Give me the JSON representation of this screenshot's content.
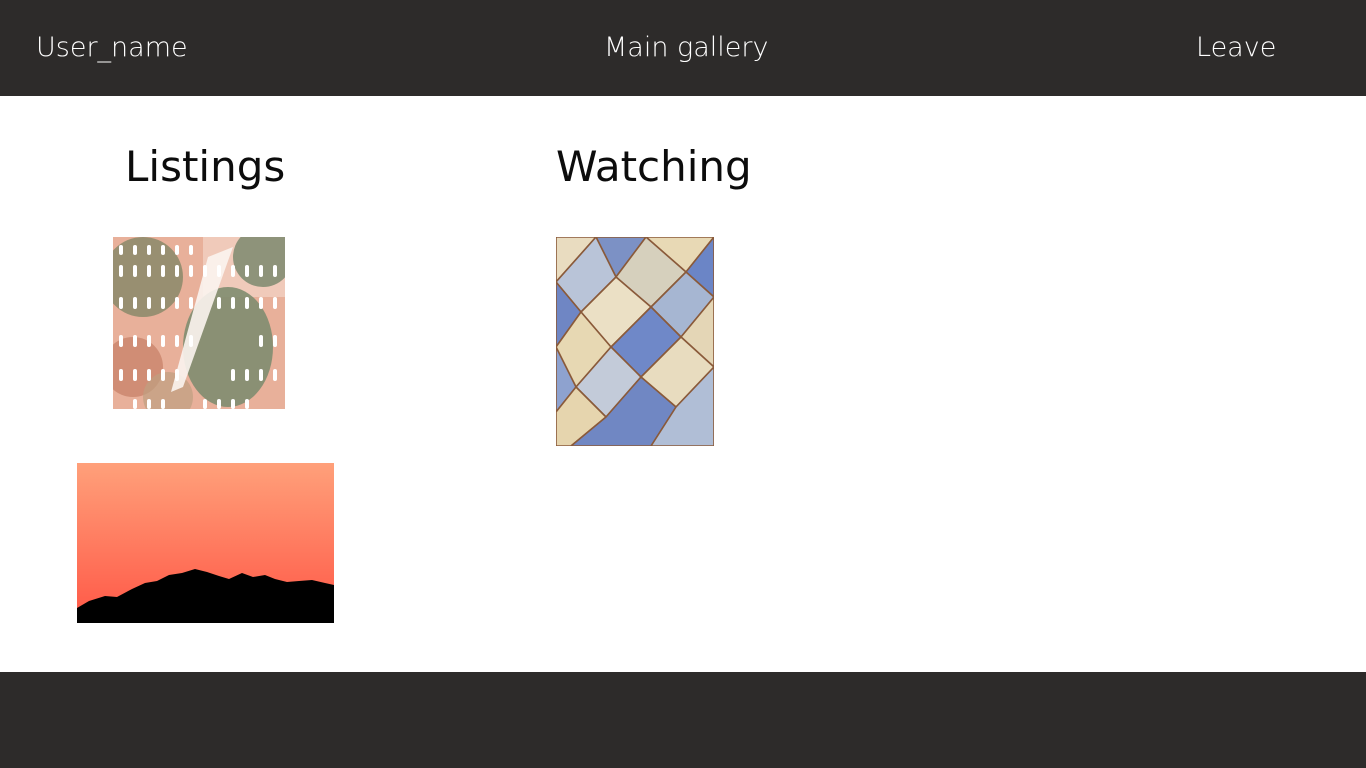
{
  "header": {
    "user_label": "User_name",
    "title": "Main gallery",
    "leave_label": "Leave"
  },
  "sections": {
    "listings_title": "Listings",
    "watching_title": "Watching"
  },
  "colors": {
    "bar": "#2d2b2a",
    "background": "#ffffff",
    "sunset_top": "#ffa07a",
    "sunset_bottom": "#ff5c4a"
  }
}
